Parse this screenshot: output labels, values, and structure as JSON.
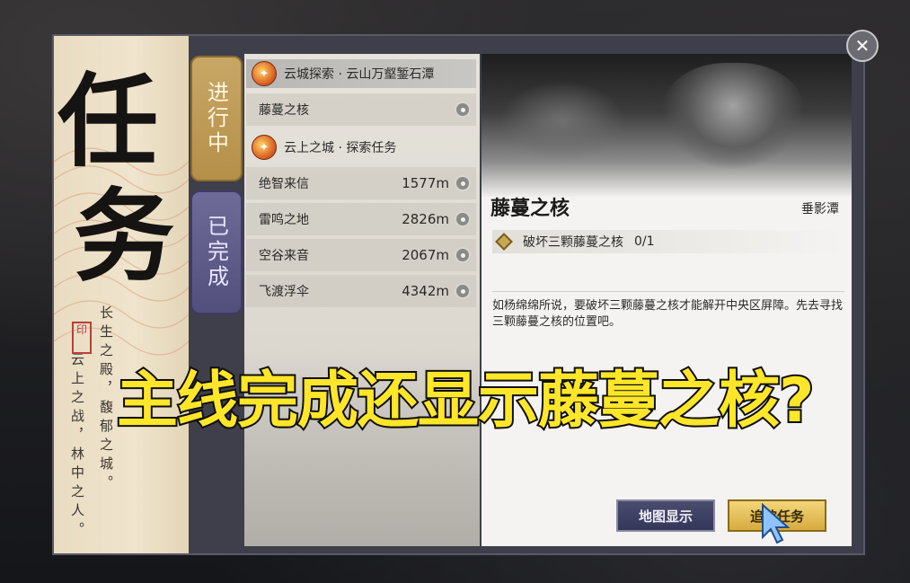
{
  "panel": {
    "title_chars": [
      "任",
      "务"
    ],
    "poem_col1": "长生之殿，馥郁之城。",
    "poem_col2": "云上之战，林中之人。",
    "seal": "印"
  },
  "tabs": {
    "in_progress": "进行中",
    "completed": "已完成"
  },
  "quest_list": {
    "group1": {
      "title": "云城探索 · 云山万壑錾石潭",
      "icon": "quest-emblem-icon"
    },
    "group1_items": [
      {
        "name": "藤蔓之核",
        "distance": ""
      }
    ],
    "group2": {
      "title": "云上之城 · 探索任务",
      "icon": "quest-emblem-icon"
    },
    "group2_items": [
      {
        "name": "绝智来信",
        "distance": "1577m"
      },
      {
        "name": "雷鸣之地",
        "distance": "2826m"
      },
      {
        "name": "空谷来音",
        "distance": "2067m"
      },
      {
        "name": "飞渡浮伞",
        "distance": "4342m"
      }
    ]
  },
  "detail": {
    "title": "藤蔓之核",
    "location": "垂影潭",
    "objective": "破坏三颗藤蔓之核",
    "objective_count": "0/1",
    "description": "如杨绵绵所说，要破坏三颗藤蔓之核才能解开中央区屏障。先去寻找三颗藤蔓之核的位置吧。",
    "map_button": "地图显示",
    "track_button": "追踪任务"
  },
  "close_icon": "close-icon",
  "overlay_caption": "主线完成还显示藤蔓之核?",
  "colors": {
    "accent_gold": "#c8a766",
    "accent_purple": "#5b5788",
    "caption_yellow": "#ffe629"
  }
}
